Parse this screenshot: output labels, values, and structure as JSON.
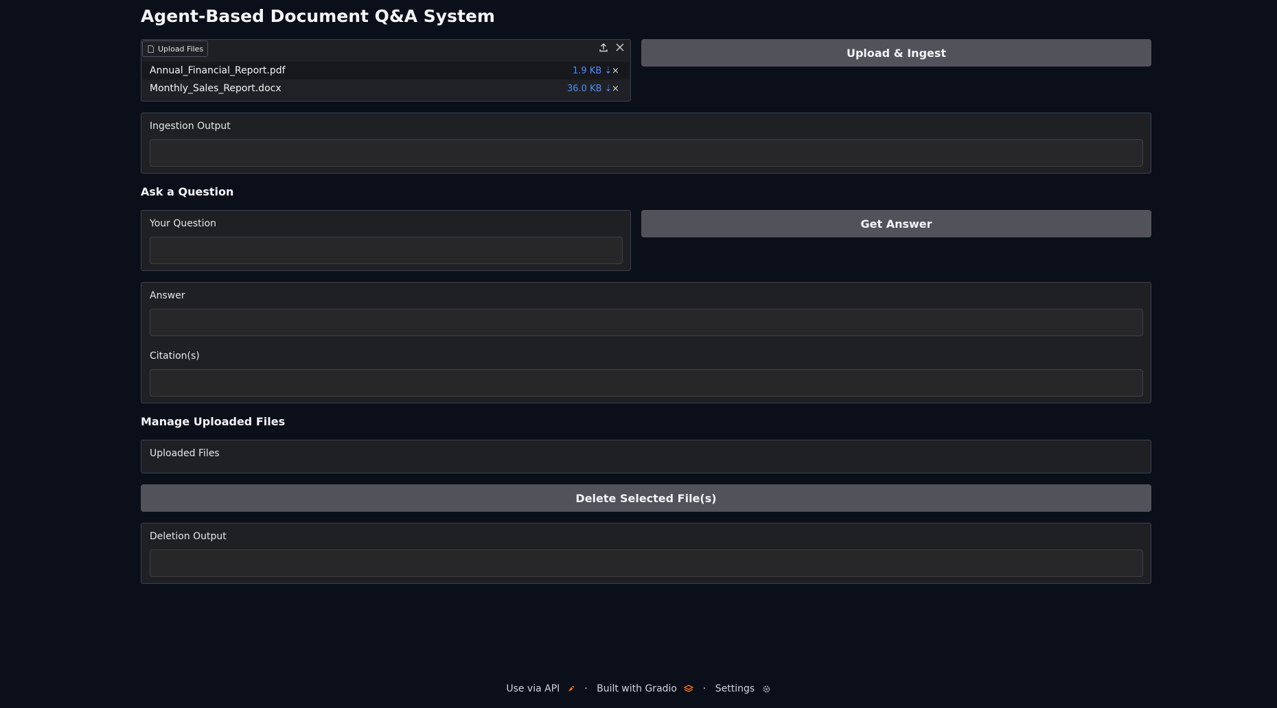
{
  "app": {
    "title": "Agent-Based Document Q&A System"
  },
  "upload": {
    "tab_label": "Upload Files",
    "files": [
      {
        "name": "Annual_Financial_Report.pdf",
        "size": "1.9 KB ⇣",
        "remove": "×"
      },
      {
        "name": "Monthly_Sales_Report.docx",
        "size": "36.0 KB ⇣",
        "remove": "×"
      }
    ],
    "ingest_button": "Upload & Ingest"
  },
  "ingestion": {
    "label": "Ingestion Output",
    "value": ""
  },
  "ask": {
    "section_title": "Ask a Question",
    "question_label": "Your Question",
    "question_value": "",
    "get_answer_button": "Get Answer"
  },
  "answer": {
    "label": "Answer",
    "value": "",
    "citations_label": "Citation(s)",
    "citations_value": ""
  },
  "manage": {
    "section_title": "Manage Uploaded Files",
    "uploaded_files_label": "Uploaded Files",
    "delete_button": "Delete Selected File(s)"
  },
  "deletion": {
    "label": "Deletion Output",
    "value": ""
  },
  "footer": {
    "api": "Use via API",
    "sep1": "·",
    "built": "Built with Gradio",
    "sep2": "·",
    "settings": "Settings"
  },
  "colors": {
    "background": "#0b0f19",
    "panel": "#1f2024",
    "button": "#52525b",
    "accent": "#4f8cff",
    "gradio_orange": "#f97316"
  }
}
